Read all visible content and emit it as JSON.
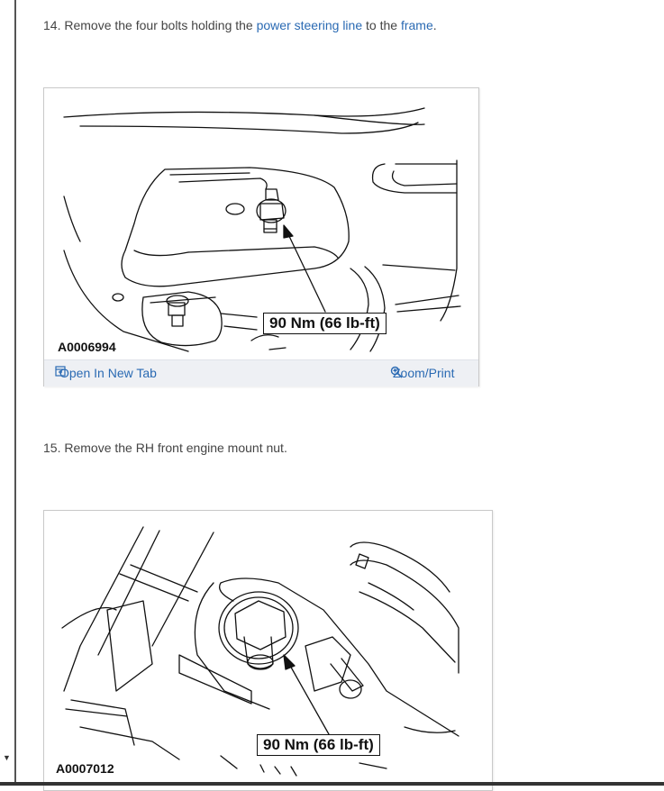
{
  "steps": [
    {
      "number": "14.",
      "text_before": "Remove the four bolts holding the",
      "link1": "power steering line",
      "text_mid": "to the",
      "link2": "frame",
      "text_after": "."
    },
    {
      "number": "15.",
      "text": "Remove the RH front engine mount nut."
    }
  ],
  "figures": [
    {
      "id": "A0006994",
      "callout": "90 Nm (66 lb-ft)",
      "open_label": "Open In New Tab",
      "zoom_label": "Zoom/Print"
    },
    {
      "id": "A0007012",
      "callout": "90 Nm (66 lb-ft)"
    }
  ],
  "colors": {
    "link": "#2a6ab3",
    "toolbar_bg": "#eef0f4"
  },
  "icons": [
    "open-new-tab-icon",
    "zoom-magnifier-icon",
    "scroll-down-arrow-icon"
  ]
}
